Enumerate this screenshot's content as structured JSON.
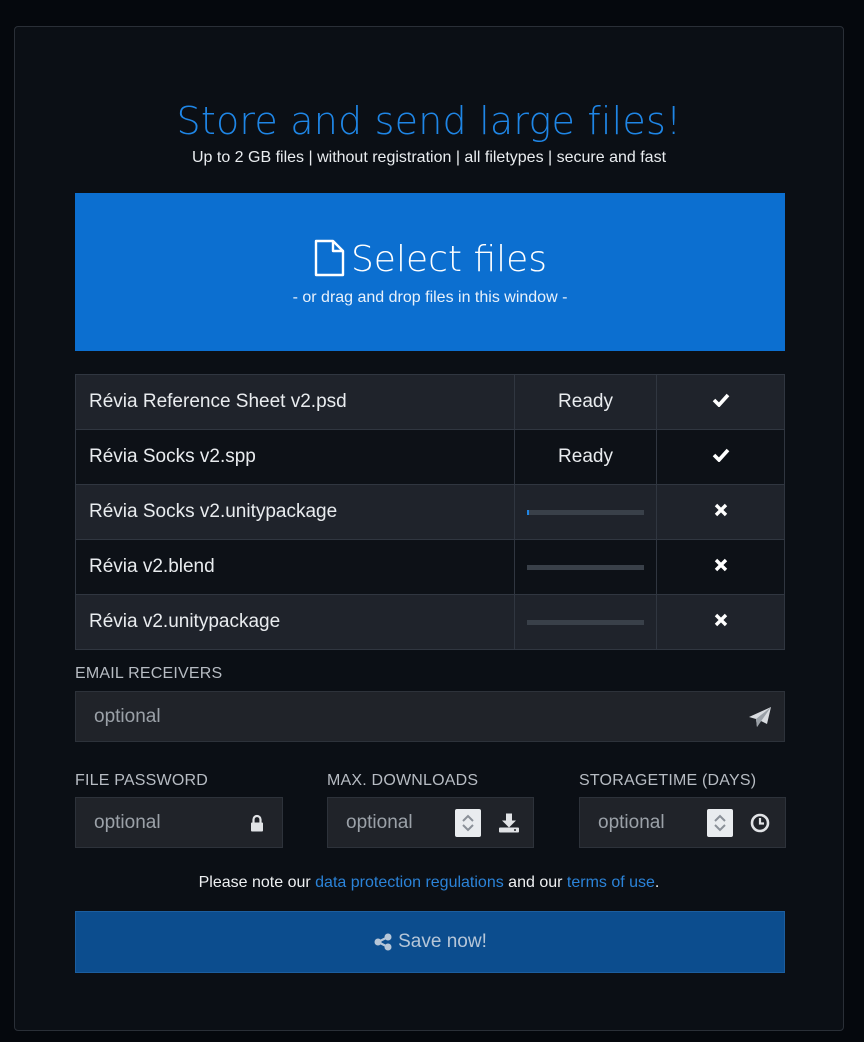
{
  "header": {
    "title": "Store and send large files!",
    "subtitle": "Up to 2 GB files | without registration | all filetypes | secure and fast"
  },
  "upload": {
    "main_label": "Select files",
    "sub_label": "- or drag and drop files in this window -",
    "icon": "file-icon"
  },
  "files": [
    {
      "name": "Révia Reference Sheet v2.psd",
      "status": "Ready",
      "progress": null,
      "action": "check-icon"
    },
    {
      "name": "Révia Socks v2.spp",
      "status": "Ready",
      "progress": null,
      "action": "check-icon"
    },
    {
      "name": "Révia Socks v2.unitypackage",
      "status": "",
      "progress": 0.02,
      "action": "close-icon"
    },
    {
      "name": "Révia v2.blend",
      "status": "",
      "progress": 0,
      "action": "close-icon"
    },
    {
      "name": "Révia v2.unitypackage",
      "status": "",
      "progress": 0,
      "action": "close-icon"
    }
  ],
  "email": {
    "label": "EMAIL RECEIVERS",
    "placeholder": "optional",
    "icon": "paper-plane-icon"
  },
  "password": {
    "label": "FILE PASSWORD",
    "placeholder": "optional",
    "icon": "lock-icon"
  },
  "max_downloads": {
    "label": "MAX. DOWNLOADS",
    "placeholder": "optional",
    "icon": "download-icon"
  },
  "storagetime": {
    "label": "STORAGETIME (DAYS)",
    "placeholder": "optional",
    "icon": "clock-icon"
  },
  "note": {
    "prefix": "Please note our ",
    "link1": "data protection regulations",
    "middle": " and our ",
    "link2": "terms of use",
    "suffix": "."
  },
  "save_button": {
    "label": "Save now!",
    "icon": "share-icon"
  },
  "colors": {
    "accent": "#1f86e6",
    "select_bg": "#0c6fd0",
    "save_bg": "#0c4d8e",
    "card_bg": "#0b0f15"
  }
}
